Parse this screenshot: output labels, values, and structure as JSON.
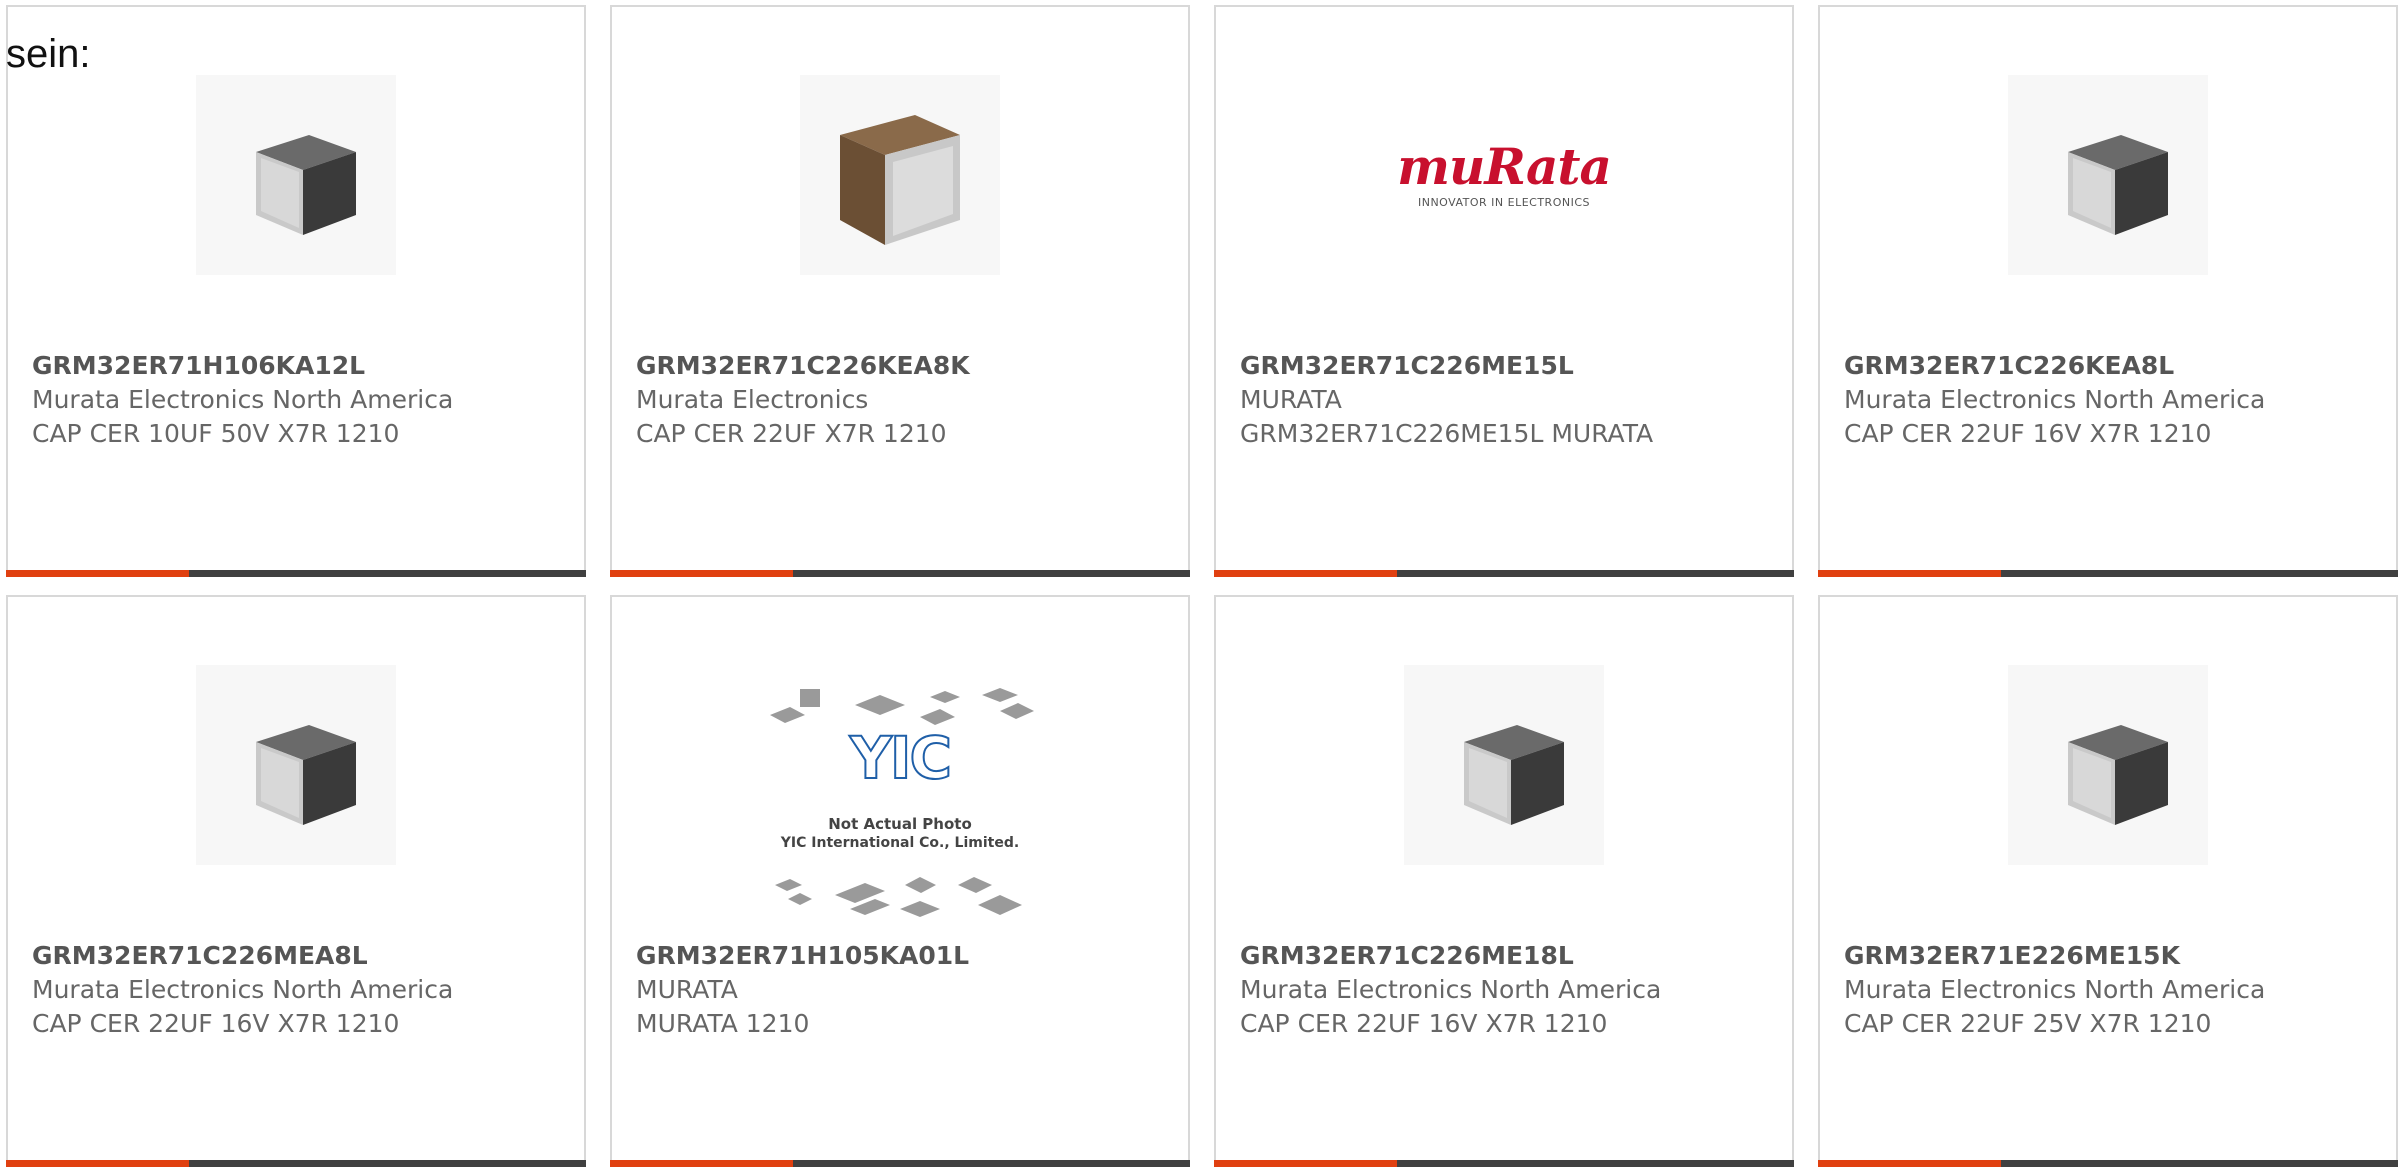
{
  "intro_text": "sein:",
  "colors": {
    "accent": "#e04010",
    "bar": "#404040",
    "border": "#d8d8d8",
    "text": "#666666"
  },
  "cards": [
    {
      "part": "GRM32ER71H106KA12L",
      "maker": "Murata Electronics North America",
      "desc": "CAP CER 10UF 50V X7R 1210",
      "image": "dark-chip-icon"
    },
    {
      "part": "GRM32ER71C226KEA8K",
      "maker": "Murata Electronics",
      "desc": "CAP CER 22UF X7R 1210",
      "image": "brown-chip-icon"
    },
    {
      "part": "GRM32ER71C226ME15L",
      "maker": "MURATA",
      "desc": "GRM32ER71C226ME15L MURATA",
      "image": "murata-logo",
      "logo": {
        "brand": "muRata",
        "tagline": "INNOVATOR IN ELECTRONICS"
      }
    },
    {
      "part": "GRM32ER71C226KEA8L",
      "maker": "Murata Electronics North America",
      "desc": "CAP CER 22UF 16V X7R 1210",
      "image": "dark-chip-icon"
    },
    {
      "part": "GRM32ER71C226MEA8L",
      "maker": "Murata Electronics North America",
      "desc": "CAP CER 22UF 16V X7R 1210",
      "image": "dark-chip-icon"
    },
    {
      "part": "GRM32ER71H105KA01L",
      "maker": "MURATA",
      "desc": "MURATA 1210",
      "image": "yic-placeholder",
      "placeholder": {
        "logo": "YIC",
        "line1": "Not Actual Photo",
        "line2": "YIC International Co., Limited."
      }
    },
    {
      "part": "GRM32ER71C226ME18L",
      "maker": "Murata Electronics North America",
      "desc": "CAP CER 22UF 16V X7R 1210",
      "image": "dark-chip-icon"
    },
    {
      "part": "GRM32ER71E226ME15K",
      "maker": "Murata Electronics North America",
      "desc": "CAP CER 22UF 25V X7R 1210",
      "image": "dark-chip-icon"
    }
  ]
}
